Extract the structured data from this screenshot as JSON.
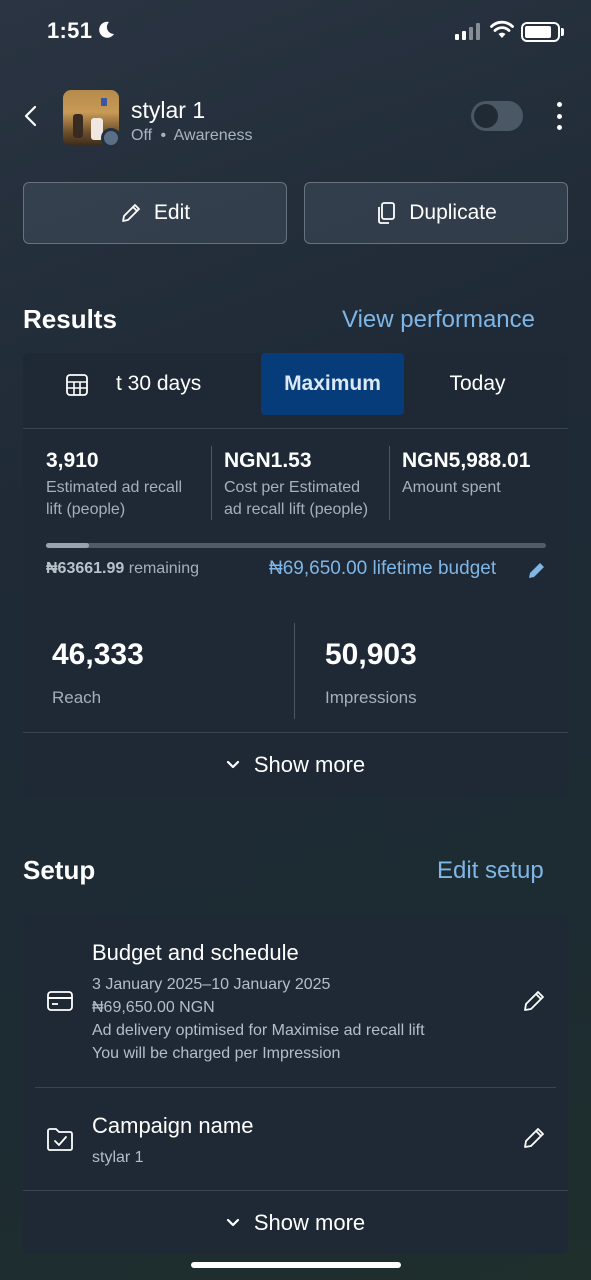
{
  "status_bar": {
    "time": "1:51"
  },
  "header": {
    "title": "stylar 1",
    "status": "Off",
    "separator": "•",
    "objective": "Awareness"
  },
  "actions": {
    "edit_label": "Edit",
    "duplicate_label": "Duplicate"
  },
  "results": {
    "heading": "Results",
    "view_link": "View performance",
    "tabs": [
      {
        "label": "t 30 days",
        "active": false
      },
      {
        "label": "Maximum",
        "active": true
      },
      {
        "label": "Today",
        "active": false
      }
    ],
    "stats": [
      {
        "value": "3,910",
        "label_line1": "Estimated ad recall",
        "label_line2": "lift (people)"
      },
      {
        "value": "NGN1.53",
        "label_line1": "Cost per Estimated",
        "label_line2": "ad recall lift (people)"
      },
      {
        "value": "NGN5,988.01",
        "label_line1": "Amount spent",
        "label_line2": ""
      }
    ],
    "budget": {
      "remaining_value": "₦63661.99",
      "remaining_label": "remaining",
      "lifetime": "₦69,650.00 lifetime budget",
      "spent_fraction": 0.086
    },
    "reach": {
      "value": "46,333",
      "label": "Reach"
    },
    "impressions": {
      "value": "50,903",
      "label": "Impressions"
    },
    "show_more": "Show more"
  },
  "setup": {
    "heading": "Setup",
    "edit_link": "Edit setup",
    "budget_schedule": {
      "title": "Budget and schedule",
      "line1": "3 January 2025–10 January 2025",
      "line2": "₦69,650.00 NGN",
      "line3": "Ad delivery optimised for Maximise ad recall lift",
      "line4": "You will be charged per Impression"
    },
    "campaign": {
      "title": "Campaign name",
      "value": "stylar 1"
    },
    "show_more": "Show more"
  },
  "colors": {
    "accent_link": "#7fb6e6",
    "active_tab": "#073c7a",
    "card": "#1e2935"
  }
}
